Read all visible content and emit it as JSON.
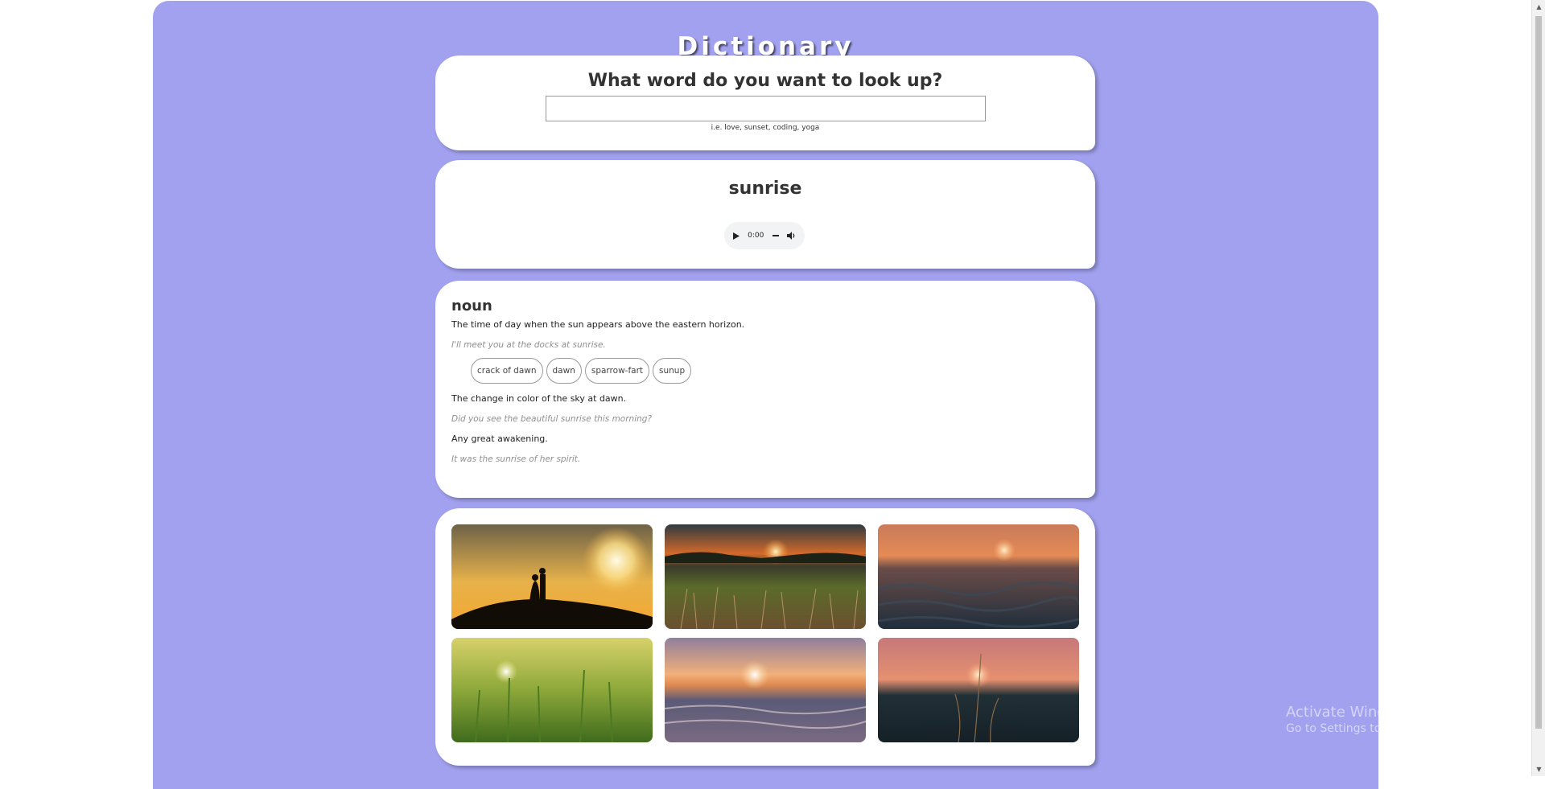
{
  "app": {
    "title": "Dictionary"
  },
  "search": {
    "heading": "What word do you want to look up?",
    "value": "",
    "hint": "i.e. love, sunset, coding, yoga"
  },
  "word": {
    "title": "sunrise",
    "audio": {
      "time": "0:00",
      "icons": [
        "play-icon",
        "progress-dash",
        "volume-icon"
      ]
    }
  },
  "meaning": {
    "part_of_speech": "noun",
    "definitions": [
      {
        "text": "The time of day when the sun appears above the eastern horizon.",
        "example": "I'll meet you at the docks at sunrise.",
        "synonyms": [
          "crack of dawn",
          "dawn",
          "sparrow-fart",
          "sunup"
        ]
      },
      {
        "text": "The change in color of the sky at dawn.",
        "example": "Did you see the beautiful sunrise this morning?"
      },
      {
        "text": "Any great awakening.",
        "example": "It was the sunrise of her spirit."
      }
    ]
  },
  "images": [
    {
      "name": "couple-silhouette-sunset-photo"
    },
    {
      "name": "grass-field-sunrise-photo"
    },
    {
      "name": "ocean-waves-sunset-photo"
    },
    {
      "name": "wheat-field-sun-photo"
    },
    {
      "name": "beach-waves-sunrise-photo"
    },
    {
      "name": "grass-silhouette-sunset-photo"
    }
  ],
  "watermark": {
    "title": "Activate Windows",
    "subtitle": "Go to Settings to activate Windows."
  },
  "colors": {
    "background": "#a1a1ef",
    "card": "#ffffff",
    "example_text": "#909090"
  }
}
